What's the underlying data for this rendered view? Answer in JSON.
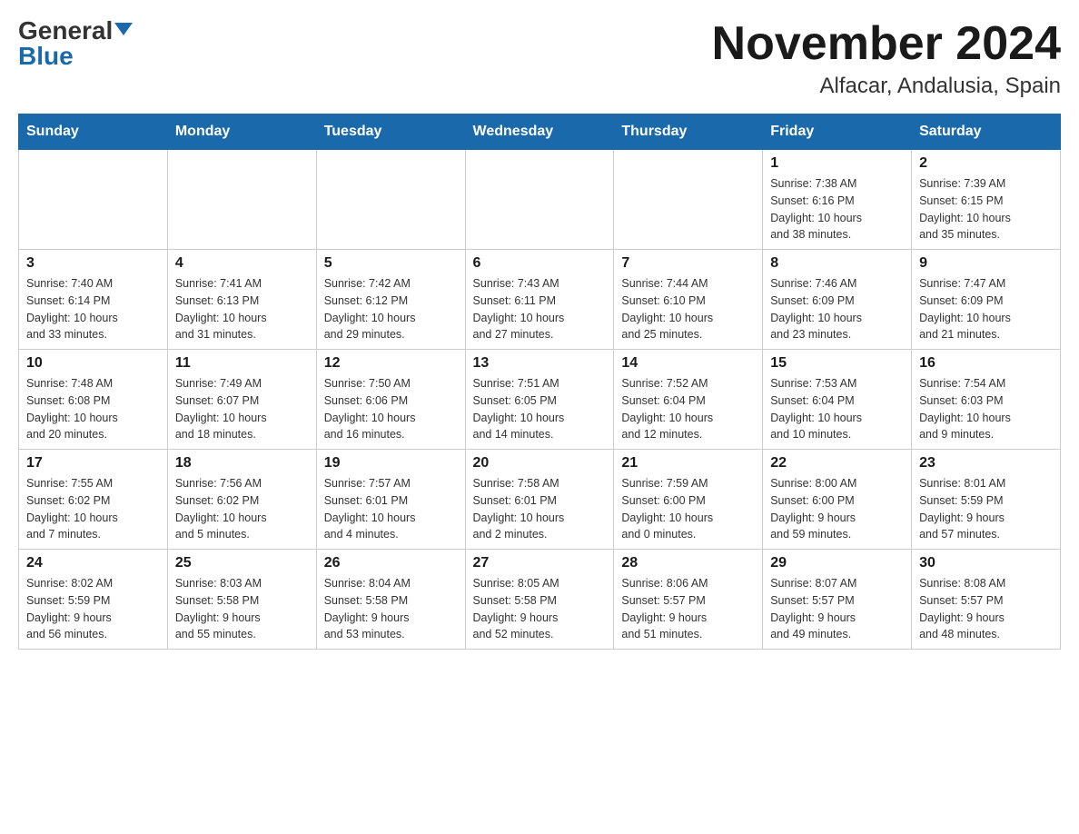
{
  "header": {
    "logo_general": "General",
    "logo_blue": "Blue",
    "month_title": "November 2024",
    "location": "Alfacar, Andalusia, Spain"
  },
  "weekdays": [
    "Sunday",
    "Monday",
    "Tuesday",
    "Wednesday",
    "Thursday",
    "Friday",
    "Saturday"
  ],
  "weeks": [
    [
      {
        "day": "",
        "info": ""
      },
      {
        "day": "",
        "info": ""
      },
      {
        "day": "",
        "info": ""
      },
      {
        "day": "",
        "info": ""
      },
      {
        "day": "",
        "info": ""
      },
      {
        "day": "1",
        "info": "Sunrise: 7:38 AM\nSunset: 6:16 PM\nDaylight: 10 hours\nand 38 minutes."
      },
      {
        "day": "2",
        "info": "Sunrise: 7:39 AM\nSunset: 6:15 PM\nDaylight: 10 hours\nand 35 minutes."
      }
    ],
    [
      {
        "day": "3",
        "info": "Sunrise: 7:40 AM\nSunset: 6:14 PM\nDaylight: 10 hours\nand 33 minutes."
      },
      {
        "day": "4",
        "info": "Sunrise: 7:41 AM\nSunset: 6:13 PM\nDaylight: 10 hours\nand 31 minutes."
      },
      {
        "day": "5",
        "info": "Sunrise: 7:42 AM\nSunset: 6:12 PM\nDaylight: 10 hours\nand 29 minutes."
      },
      {
        "day": "6",
        "info": "Sunrise: 7:43 AM\nSunset: 6:11 PM\nDaylight: 10 hours\nand 27 minutes."
      },
      {
        "day": "7",
        "info": "Sunrise: 7:44 AM\nSunset: 6:10 PM\nDaylight: 10 hours\nand 25 minutes."
      },
      {
        "day": "8",
        "info": "Sunrise: 7:46 AM\nSunset: 6:09 PM\nDaylight: 10 hours\nand 23 minutes."
      },
      {
        "day": "9",
        "info": "Sunrise: 7:47 AM\nSunset: 6:09 PM\nDaylight: 10 hours\nand 21 minutes."
      }
    ],
    [
      {
        "day": "10",
        "info": "Sunrise: 7:48 AM\nSunset: 6:08 PM\nDaylight: 10 hours\nand 20 minutes."
      },
      {
        "day": "11",
        "info": "Sunrise: 7:49 AM\nSunset: 6:07 PM\nDaylight: 10 hours\nand 18 minutes."
      },
      {
        "day": "12",
        "info": "Sunrise: 7:50 AM\nSunset: 6:06 PM\nDaylight: 10 hours\nand 16 minutes."
      },
      {
        "day": "13",
        "info": "Sunrise: 7:51 AM\nSunset: 6:05 PM\nDaylight: 10 hours\nand 14 minutes."
      },
      {
        "day": "14",
        "info": "Sunrise: 7:52 AM\nSunset: 6:04 PM\nDaylight: 10 hours\nand 12 minutes."
      },
      {
        "day": "15",
        "info": "Sunrise: 7:53 AM\nSunset: 6:04 PM\nDaylight: 10 hours\nand 10 minutes."
      },
      {
        "day": "16",
        "info": "Sunrise: 7:54 AM\nSunset: 6:03 PM\nDaylight: 10 hours\nand 9 minutes."
      }
    ],
    [
      {
        "day": "17",
        "info": "Sunrise: 7:55 AM\nSunset: 6:02 PM\nDaylight: 10 hours\nand 7 minutes."
      },
      {
        "day": "18",
        "info": "Sunrise: 7:56 AM\nSunset: 6:02 PM\nDaylight: 10 hours\nand 5 minutes."
      },
      {
        "day": "19",
        "info": "Sunrise: 7:57 AM\nSunset: 6:01 PM\nDaylight: 10 hours\nand 4 minutes."
      },
      {
        "day": "20",
        "info": "Sunrise: 7:58 AM\nSunset: 6:01 PM\nDaylight: 10 hours\nand 2 minutes."
      },
      {
        "day": "21",
        "info": "Sunrise: 7:59 AM\nSunset: 6:00 PM\nDaylight: 10 hours\nand 0 minutes."
      },
      {
        "day": "22",
        "info": "Sunrise: 8:00 AM\nSunset: 6:00 PM\nDaylight: 9 hours\nand 59 minutes."
      },
      {
        "day": "23",
        "info": "Sunrise: 8:01 AM\nSunset: 5:59 PM\nDaylight: 9 hours\nand 57 minutes."
      }
    ],
    [
      {
        "day": "24",
        "info": "Sunrise: 8:02 AM\nSunset: 5:59 PM\nDaylight: 9 hours\nand 56 minutes."
      },
      {
        "day": "25",
        "info": "Sunrise: 8:03 AM\nSunset: 5:58 PM\nDaylight: 9 hours\nand 55 minutes."
      },
      {
        "day": "26",
        "info": "Sunrise: 8:04 AM\nSunset: 5:58 PM\nDaylight: 9 hours\nand 53 minutes."
      },
      {
        "day": "27",
        "info": "Sunrise: 8:05 AM\nSunset: 5:58 PM\nDaylight: 9 hours\nand 52 minutes."
      },
      {
        "day": "28",
        "info": "Sunrise: 8:06 AM\nSunset: 5:57 PM\nDaylight: 9 hours\nand 51 minutes."
      },
      {
        "day": "29",
        "info": "Sunrise: 8:07 AM\nSunset: 5:57 PM\nDaylight: 9 hours\nand 49 minutes."
      },
      {
        "day": "30",
        "info": "Sunrise: 8:08 AM\nSunset: 5:57 PM\nDaylight: 9 hours\nand 48 minutes."
      }
    ]
  ]
}
